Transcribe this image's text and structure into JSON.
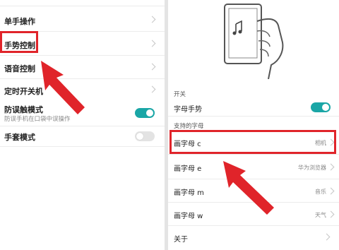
{
  "left": {
    "items": [
      {
        "label": "单手操作"
      },
      {
        "label": "手势控制"
      },
      {
        "label": "语音控制"
      },
      {
        "label": "定时开关机"
      },
      {
        "label": "防误触模式",
        "sub": "防误手机在口袋中误操作",
        "toggle": "on"
      },
      {
        "label": "手套模式",
        "toggle": "off"
      }
    ]
  },
  "right": {
    "section_switch": "开关",
    "letter_gesture_label": "字母手势",
    "section_supported": "支持的字母",
    "letters": [
      {
        "label": "画字母 c",
        "value": "相机"
      },
      {
        "label": "画字母 e",
        "value": "华为浏览器"
      },
      {
        "label": "画字母 m",
        "value": "音乐"
      },
      {
        "label": "画字母 w",
        "value": "天气"
      }
    ],
    "about_label": "关于"
  },
  "colors": {
    "accent": "#1aa6a6",
    "highlight": "#e0242a"
  }
}
